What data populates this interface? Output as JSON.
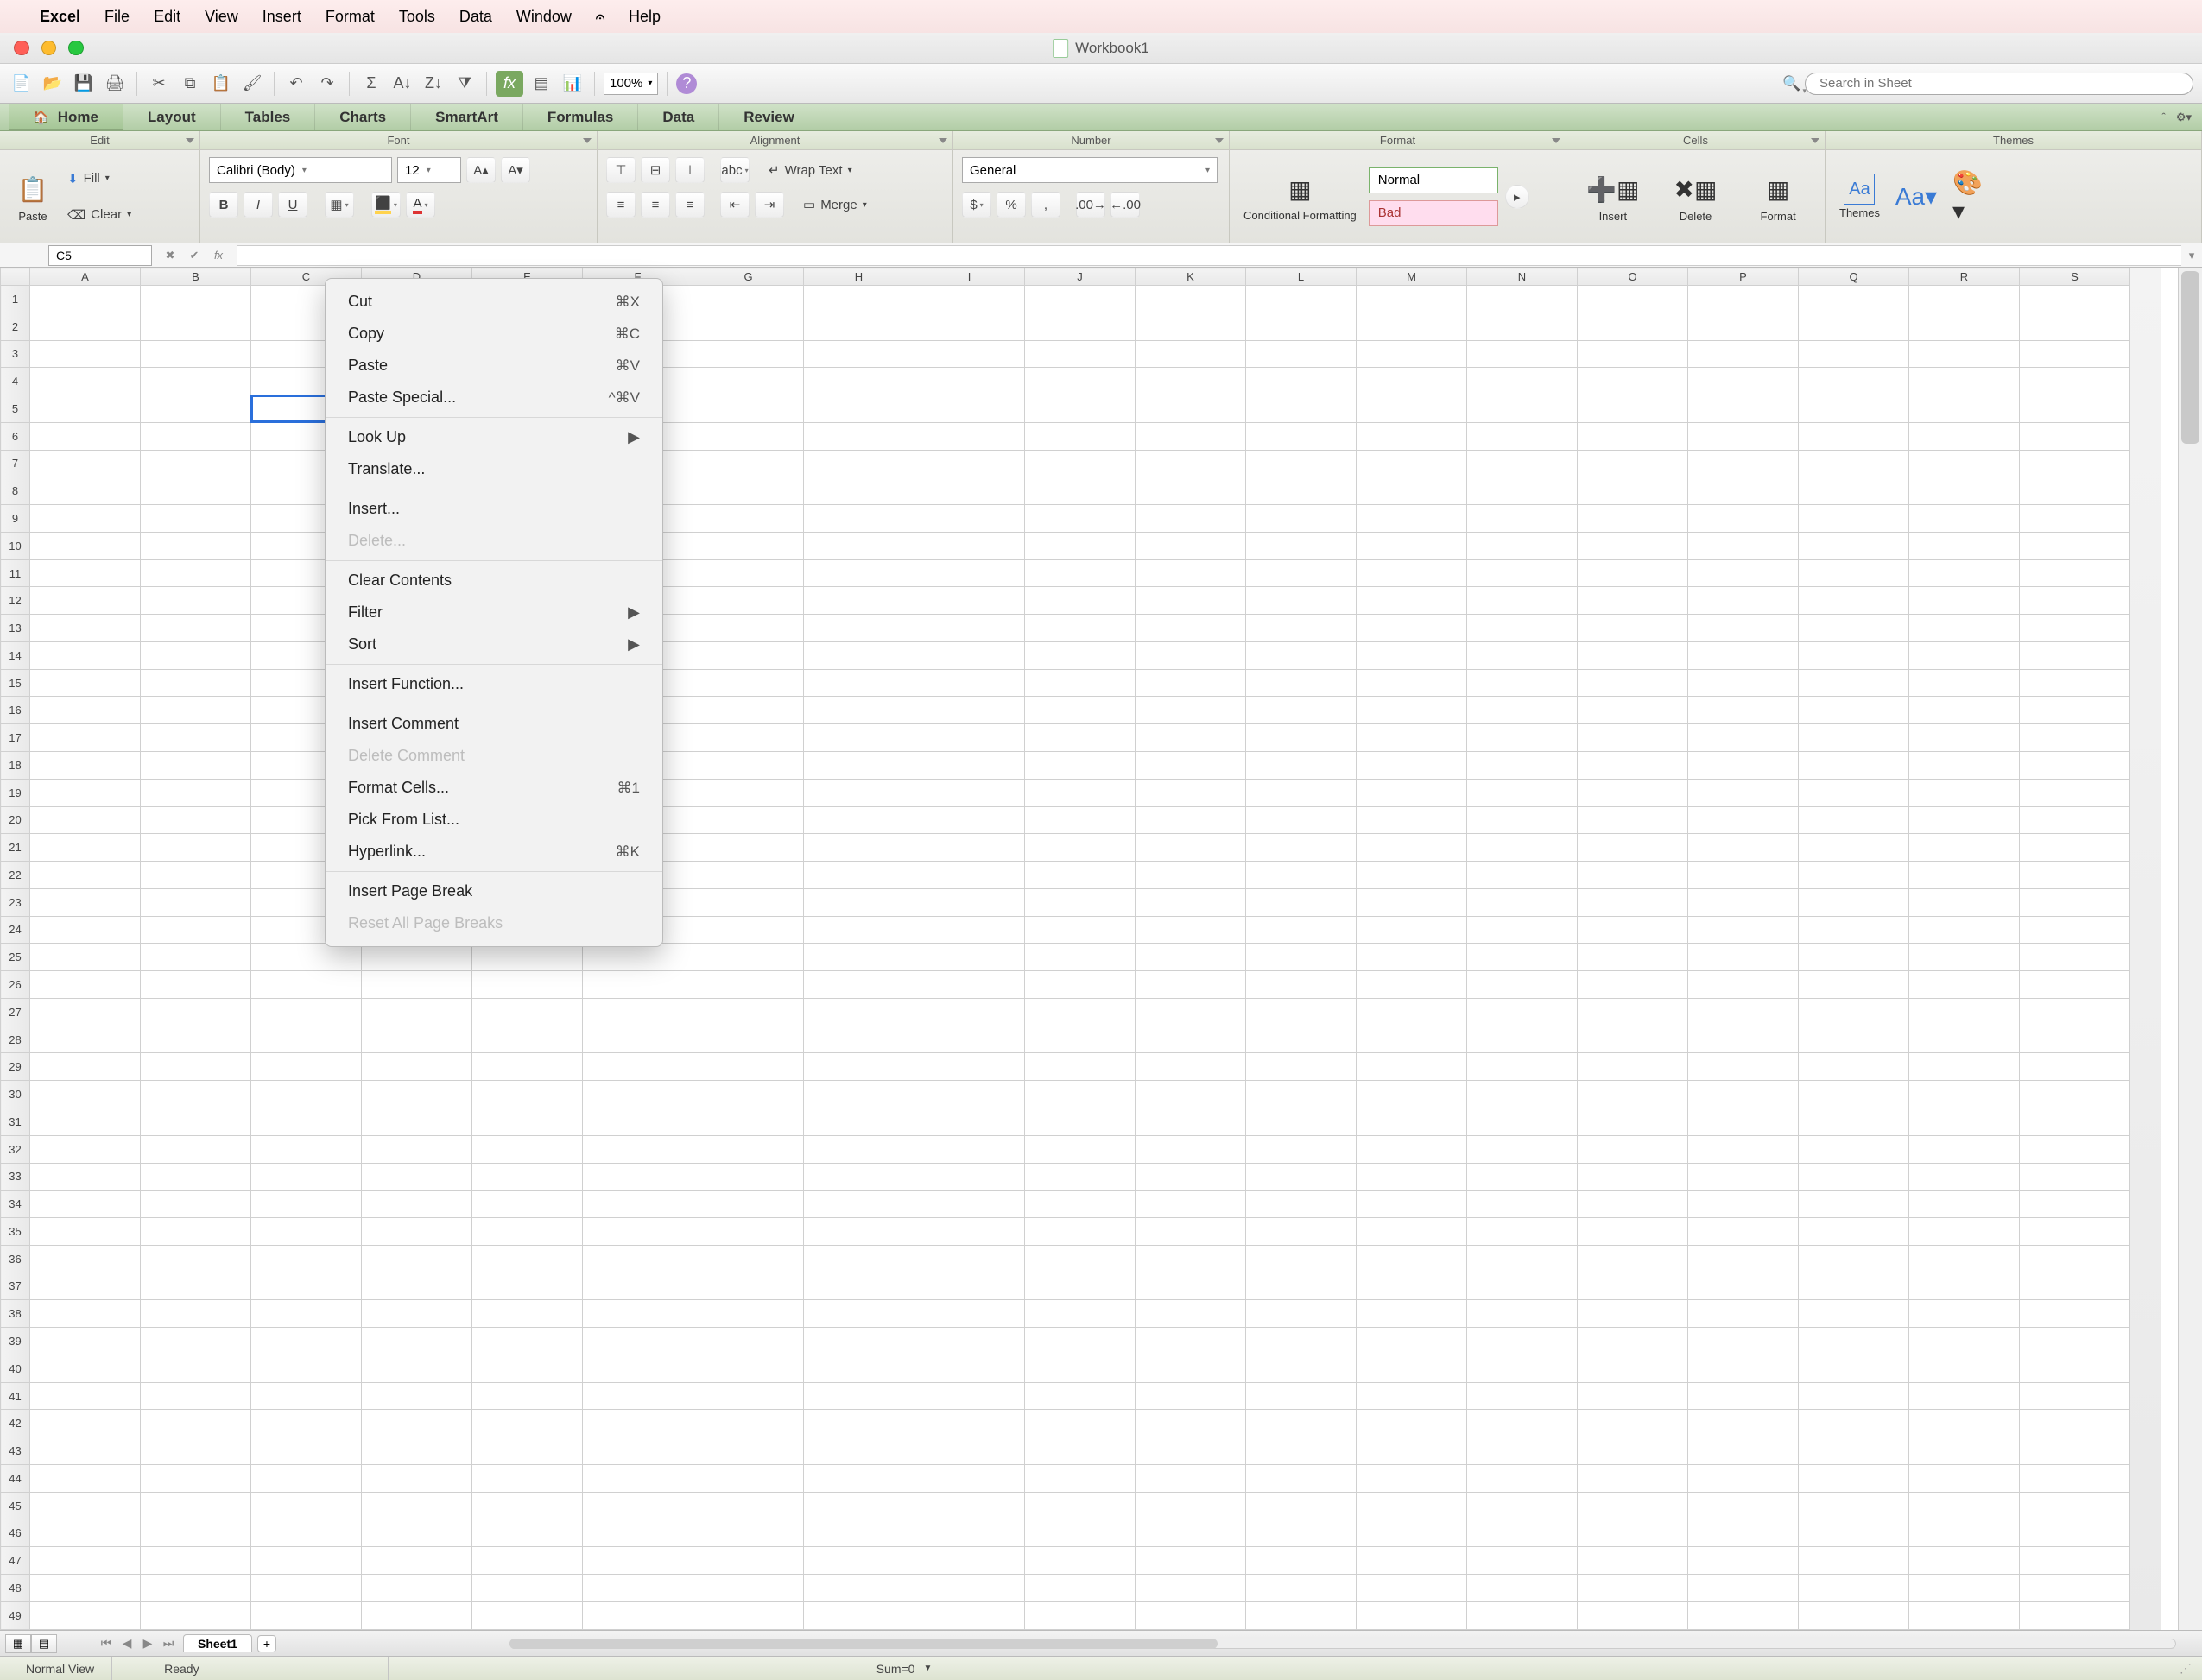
{
  "macmenu": {
    "app": "Excel",
    "items": [
      "File",
      "Edit",
      "View",
      "Insert",
      "Format",
      "Tools",
      "Data",
      "Window"
    ],
    "script": "✎",
    "help": "Help"
  },
  "window": {
    "title": "Workbook1"
  },
  "qat": {
    "zoom": "100%",
    "search_placeholder": "Search in Sheet"
  },
  "tabs": [
    "Home",
    "Layout",
    "Tables",
    "Charts",
    "SmartArt",
    "Formulas",
    "Data",
    "Review"
  ],
  "ribbon_groups": {
    "edit": {
      "label": "Edit",
      "paste": "Paste",
      "fill": "Fill",
      "clear": "Clear"
    },
    "font": {
      "label": "Font",
      "name": "Calibri (Body)",
      "size": "12"
    },
    "alignment": {
      "label": "Alignment",
      "wrap": "Wrap Text",
      "merge": "Merge"
    },
    "number": {
      "label": "Number",
      "format": "General"
    },
    "format": {
      "label": "Format",
      "cond": "Conditional Formatting",
      "normal": "Normal",
      "bad": "Bad"
    },
    "cells": {
      "label": "Cells",
      "insert": "Insert",
      "delete": "Delete",
      "format": "Format"
    },
    "themes": {
      "label": "Themes",
      "themes": "Themes",
      "aa": "Aa"
    }
  },
  "namebox": "C5",
  "columns": [
    "A",
    "B",
    "C",
    "D",
    "E",
    "F",
    "G",
    "H",
    "I",
    "J",
    "K",
    "L",
    "M",
    "N",
    "O",
    "P",
    "Q",
    "R",
    "S"
  ],
  "row_count": 49,
  "selected": {
    "col": "C",
    "row": 5
  },
  "context_menu": [
    {
      "label": "Cut",
      "shortcut": "⌘X"
    },
    {
      "label": "Copy",
      "shortcut": "⌘C"
    },
    {
      "label": "Paste",
      "shortcut": "⌘V"
    },
    {
      "label": "Paste Special...",
      "shortcut": "^⌘V"
    },
    {
      "sep": true
    },
    {
      "label": "Look Up",
      "submenu": true
    },
    {
      "label": "Translate..."
    },
    {
      "sep": true
    },
    {
      "label": "Insert..."
    },
    {
      "label": "Delete...",
      "disabled": true
    },
    {
      "sep": true
    },
    {
      "label": "Clear Contents"
    },
    {
      "label": "Filter",
      "submenu": true
    },
    {
      "label": "Sort",
      "submenu": true
    },
    {
      "sep": true
    },
    {
      "label": "Insert Function..."
    },
    {
      "sep": true
    },
    {
      "label": "Insert Comment"
    },
    {
      "label": "Delete Comment",
      "disabled": true
    },
    {
      "label": "Format Cells...",
      "shortcut": "⌘1"
    },
    {
      "label": "Pick From List..."
    },
    {
      "label": "Hyperlink...",
      "shortcut": "⌘K"
    },
    {
      "sep": true
    },
    {
      "label": "Insert Page Break"
    },
    {
      "label": "Reset All Page Breaks",
      "disabled": true
    }
  ],
  "sheet_tab": "Sheet1",
  "status": {
    "view": "Normal View",
    "state": "Ready",
    "sum": "Sum=0"
  }
}
